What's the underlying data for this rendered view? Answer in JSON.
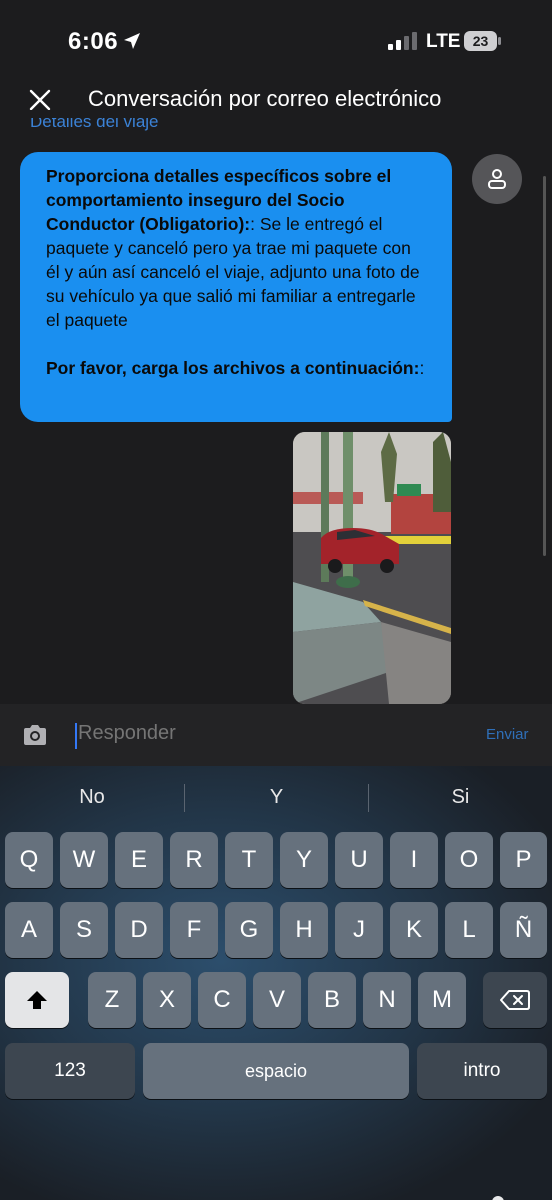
{
  "status_bar": {
    "time": "6:06",
    "network": "LTE",
    "battery": "23"
  },
  "header": {
    "title": "Conversación por correo electrónico"
  },
  "chat": {
    "trip_link": "Detalles del viaje",
    "message": {
      "q1_bold": "Proporciona detalles específicos sobre el comportamiento inseguro del Socio Conductor (Obligatorio):",
      "q1_answer": ": Se le entregó el paquete y canceló pero ya trae mi paquete con él y aún así canceló el viaje, adjunto una foto de su vehículo ya que salió mi familiar a entregarle el paquete",
      "q2_bold": "Por favor, carga los archivos a continuación:",
      "q2_answer": ":"
    }
  },
  "reply": {
    "placeholder": "Responder",
    "send_label": "Enviar"
  },
  "keyboard": {
    "suggestions": [
      "No",
      "Y",
      "Si"
    ],
    "row1": [
      "Q",
      "W",
      "E",
      "R",
      "T",
      "Y",
      "U",
      "I",
      "O",
      "P"
    ],
    "row2": [
      "A",
      "S",
      "D",
      "F",
      "G",
      "H",
      "J",
      "K",
      "L",
      "Ñ"
    ],
    "row3": [
      "Z",
      "X",
      "C",
      "V",
      "B",
      "N",
      "M"
    ],
    "numbers_label": "123",
    "space_label": "espacio",
    "return_label": "intro"
  },
  "colors": {
    "bubble": "#1a8ff0",
    "accent": "#3478f6",
    "send": "#2f6fb8"
  }
}
